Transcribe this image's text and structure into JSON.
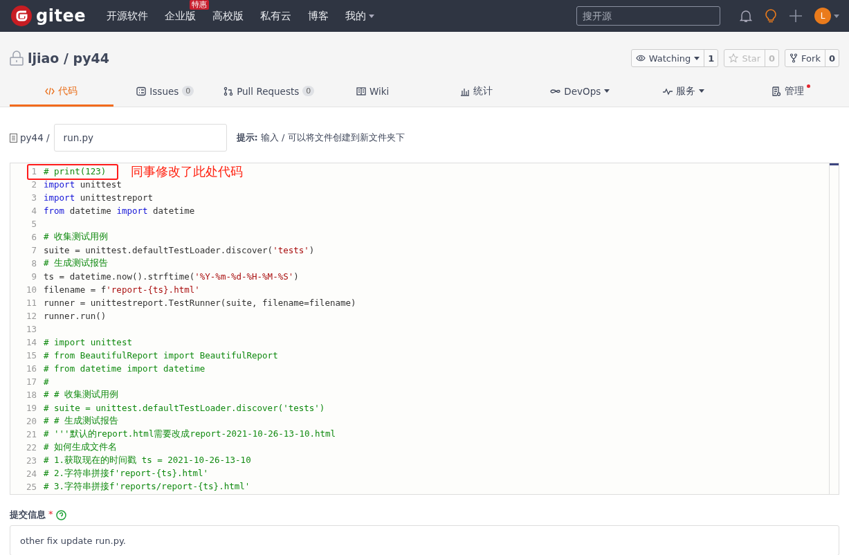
{
  "navbar": {
    "brand": "gitee",
    "items": [
      {
        "label": "开源软件",
        "dropdown": false
      },
      {
        "label": "企业版",
        "badge": "特惠",
        "dropdown": false
      },
      {
        "label": "高校版",
        "dropdown": false
      },
      {
        "label": "私有云",
        "dropdown": false
      },
      {
        "label": "博客",
        "dropdown": false
      },
      {
        "label": "我的",
        "dropdown": true
      }
    ],
    "search": {
      "placeholder": "搜开源"
    },
    "avatar": "L"
  },
  "repo": {
    "title": "ljiao / py44",
    "actions": [
      {
        "kind": "watch",
        "label": "Watching",
        "count": "1",
        "disabled": false
      },
      {
        "kind": "star",
        "label": "Star",
        "count": "0",
        "disabled": true
      },
      {
        "kind": "fork",
        "label": "Fork",
        "count": "0",
        "disabled": false
      }
    ]
  },
  "tabs": [
    {
      "kind": "code",
      "label": "代码",
      "dropdown": false,
      "dot": false,
      "selected": true
    },
    {
      "kind": "issues",
      "label": "Issues",
      "count": "0",
      "dropdown": false,
      "dot": false,
      "selected": false
    },
    {
      "kind": "pr",
      "label": "Pull Requests",
      "count": "0",
      "dropdown": false,
      "dot": false,
      "selected": false
    },
    {
      "kind": "wiki",
      "label": "Wiki",
      "dropdown": false,
      "dot": false,
      "selected": false
    },
    {
      "kind": "stats",
      "label": "统计",
      "dropdown": false,
      "dot": false,
      "selected": false
    },
    {
      "kind": "devops",
      "label": "DevOps",
      "dropdown": true,
      "dot": false,
      "selected": false
    },
    {
      "kind": "service",
      "label": "服务",
      "dropdown": true,
      "dot": false,
      "selected": false
    },
    {
      "kind": "manage",
      "label": "管理",
      "dropdown": false,
      "dot": true,
      "selected": false
    }
  ],
  "path": {
    "folder": "py44 /",
    "filename": "run.py",
    "hint_label": "提示:",
    "hint": "输入 / 可以将文件创建到新文件夹下"
  },
  "editor": {
    "annotation": "同事修改了此处代码",
    "lines": [
      {
        "number": "1",
        "boxed": true,
        "tokens": [
          {
            "kind": "comment",
            "text": "# print(123)"
          }
        ]
      },
      {
        "number": "2",
        "boxed": false,
        "tokens": [
          {
            "kind": "keyword",
            "text": "import"
          },
          {
            "kind": "plain",
            "text": " unittest"
          }
        ]
      },
      {
        "number": "3",
        "boxed": false,
        "tokens": [
          {
            "kind": "keyword",
            "text": "import"
          },
          {
            "kind": "plain",
            "text": " unittestreport"
          }
        ]
      },
      {
        "number": "4",
        "boxed": false,
        "tokens": [
          {
            "kind": "keyword",
            "text": "from"
          },
          {
            "kind": "plain",
            "text": " datetime "
          },
          {
            "kind": "keyword",
            "text": "import"
          },
          {
            "kind": "plain",
            "text": " datetime"
          }
        ]
      },
      {
        "number": "5",
        "boxed": false
      },
      {
        "number": "6",
        "boxed": false,
        "tokens": [
          {
            "kind": "comment",
            "text": "# 收集测试用例"
          }
        ]
      },
      {
        "number": "7",
        "boxed": false,
        "tokens": [
          {
            "kind": "plain",
            "text": "suite = unittest.defaultTestLoader.discover("
          },
          {
            "kind": "string",
            "text": "'tests'"
          },
          {
            "kind": "plain",
            "text": ")"
          }
        ]
      },
      {
        "number": "8",
        "boxed": false,
        "tokens": [
          {
            "kind": "comment",
            "text": "# 生成测试报告"
          }
        ]
      },
      {
        "number": "9",
        "boxed": false,
        "tokens": [
          {
            "kind": "plain",
            "text": "ts = datetime.now().strftime("
          },
          {
            "kind": "string",
            "text": "'%Y-%m-%d-%H-%M-%S'"
          },
          {
            "kind": "plain",
            "text": ")"
          }
        ]
      },
      {
        "number": "10",
        "boxed": false,
        "tokens": [
          {
            "kind": "plain",
            "text": "filename = f"
          },
          {
            "kind": "string",
            "text": "'report-{ts}.html'"
          }
        ]
      },
      {
        "number": "11",
        "boxed": false,
        "tokens": [
          {
            "kind": "plain",
            "text": "runner = unittestreport.TestRunner(suite, filename=filename)"
          }
        ]
      },
      {
        "number": "12",
        "boxed": false,
        "tokens": [
          {
            "kind": "plain",
            "text": "runner.run()"
          }
        ]
      },
      {
        "number": "13",
        "boxed": false
      },
      {
        "number": "14",
        "boxed": false,
        "tokens": [
          {
            "kind": "comment",
            "text": "# import unittest"
          }
        ]
      },
      {
        "number": "15",
        "boxed": false,
        "tokens": [
          {
            "kind": "comment",
            "text": "# from BeautifulReport import BeautifulReport"
          }
        ]
      },
      {
        "number": "16",
        "boxed": false,
        "tokens": [
          {
            "kind": "comment",
            "text": "# from datetime import datetime"
          }
        ]
      },
      {
        "number": "17",
        "boxed": false,
        "tokens": [
          {
            "kind": "comment",
            "text": "#"
          }
        ]
      },
      {
        "number": "18",
        "boxed": false,
        "tokens": [
          {
            "kind": "comment",
            "text": "# # 收集测试用例"
          }
        ]
      },
      {
        "number": "19",
        "boxed": false,
        "tokens": [
          {
            "kind": "comment",
            "text": "# suite = unittest.defaultTestLoader.discover('tests')"
          }
        ]
      },
      {
        "number": "20",
        "boxed": false,
        "tokens": [
          {
            "kind": "comment",
            "text": "# # 生成测试报告"
          }
        ]
      },
      {
        "number": "21",
        "boxed": false,
        "tokens": [
          {
            "kind": "comment",
            "text": "# '''默认的report.html需要改成report-2021-10-26-13-10.html"
          }
        ]
      },
      {
        "number": "22",
        "boxed": false,
        "tokens": [
          {
            "kind": "comment",
            "text": "# 如何生成文件名"
          }
        ]
      },
      {
        "number": "23",
        "boxed": false,
        "tokens": [
          {
            "kind": "comment",
            "text": "# 1.获取现在的时间戳 ts = 2021-10-26-13-10"
          }
        ]
      },
      {
        "number": "24",
        "boxed": false,
        "tokens": [
          {
            "kind": "comment",
            "text": "# 2.字符串拼接f'report-{ts}.html'"
          }
        ]
      },
      {
        "number": "25",
        "boxed": false,
        "tokens": [
          {
            "kind": "comment",
            "text": "# 3.字符串拼接f'reports/report-{ts}.html'"
          }
        ]
      }
    ]
  },
  "commit": {
    "label": "提交信息",
    "required": "*",
    "value": "other fix update run.py."
  }
}
